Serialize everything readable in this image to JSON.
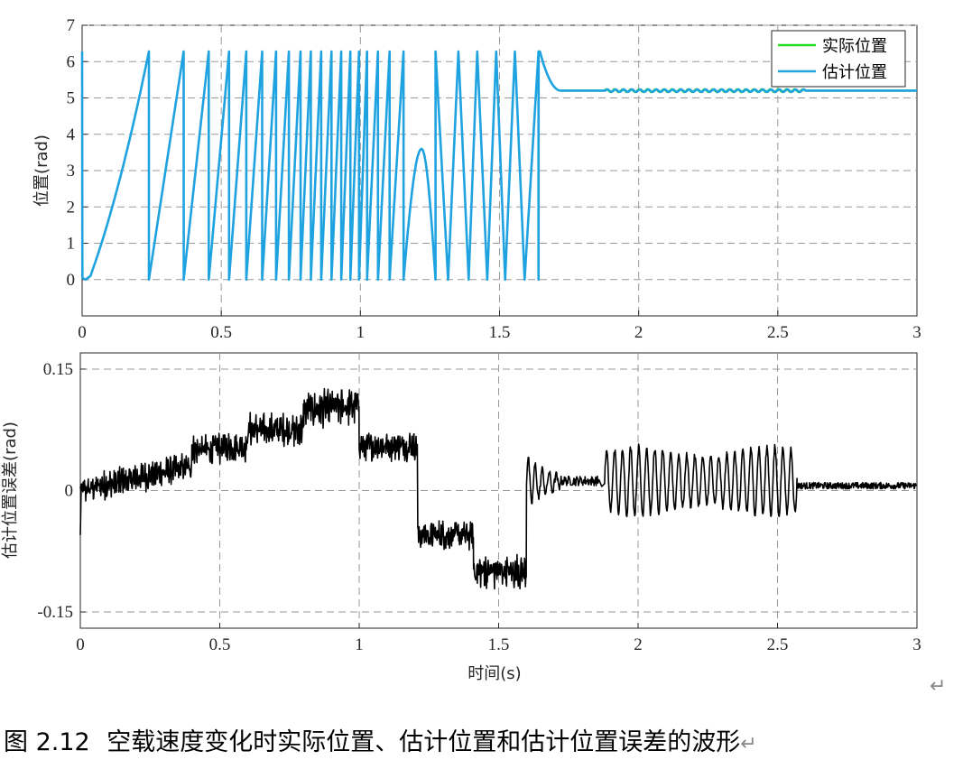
{
  "chart_data": [
    {
      "type": "line",
      "ylabel": "位置(rad)",
      "xlabel": "",
      "xlim": [
        0,
        3
      ],
      "ylim": [
        -1,
        7
      ],
      "xticks": [
        "0",
        "0.5",
        "1",
        "1.5",
        "2",
        "2.5",
        "3"
      ],
      "yticks": [
        "0",
        "1",
        "2",
        "3",
        "4",
        "5",
        "6",
        "7"
      ],
      "grid": true,
      "legend_position": "top-right",
      "series": [
        {
          "name": "实际位置",
          "color": "#22dd22"
        },
        {
          "name": "估计位置",
          "color": "#1fa3e0"
        }
      ],
      "wraps": [
        [
          0.0,
          0.24
        ],
        [
          0.24,
          0.365
        ],
        [
          0.365,
          0.455
        ],
        [
          0.455,
          0.528
        ],
        [
          0.528,
          0.59
        ],
        [
          0.59,
          0.647
        ],
        [
          0.647,
          0.697
        ],
        [
          0.697,
          0.743
        ],
        [
          0.743,
          0.785
        ],
        [
          0.785,
          0.822
        ],
        [
          0.822,
          0.859
        ],
        [
          0.859,
          0.896
        ],
        [
          0.896,
          0.931
        ],
        [
          0.931,
          0.964
        ],
        [
          0.964,
          0.995
        ],
        [
          0.995,
          1.024
        ],
        [
          1.024,
          1.063
        ],
        [
          1.063,
          1.105
        ],
        [
          1.105,
          1.155
        ]
      ],
      "bump": {
        "start": 1.155,
        "peak_t": 1.22,
        "peak_value": 3.6,
        "end": 1.27
      },
      "wraps_after_bump": [
        [
          1.27,
          1.315
        ],
        [
          1.315,
          1.352
        ],
        [
          1.352,
          1.389
        ],
        [
          1.389,
          1.42
        ],
        [
          1.42,
          1.456
        ],
        [
          1.456,
          1.488
        ],
        [
          1.488,
          1.52
        ],
        [
          1.52,
          1.555
        ],
        [
          1.555,
          1.59
        ],
        [
          1.59,
          1.64
        ]
      ],
      "steady_value": 5.2,
      "steady_start": 1.72
    },
    {
      "type": "line",
      "ylabel": "估计位置误差(rad)",
      "xlabel": "时间(s)",
      "xlim": [
        0,
        3
      ],
      "ylim": [
        -0.17,
        0.17
      ],
      "xticks": [
        "0",
        "0.5",
        "1",
        "1.5",
        "2",
        "2.5",
        "3"
      ],
      "yticks": [
        "-0.15",
        "0",
        "0.15"
      ],
      "grid": true,
      "series": [
        {
          "color": "#000000"
        }
      ],
      "segments": [
        {
          "t0": 0.0,
          "t1": 0.4,
          "v0": 0.0,
          "v1": 0.03,
          "noise": 0.013
        },
        {
          "t0": 0.4,
          "t1": 0.6,
          "v0": 0.05,
          "v1": 0.055,
          "noise": 0.014
        },
        {
          "t0": 0.6,
          "t1": 0.8,
          "v0": 0.075,
          "v1": 0.075,
          "noise": 0.015
        },
        {
          "t0": 0.8,
          "t1": 1.0,
          "v0": 0.1,
          "v1": 0.105,
          "noise": 0.017
        },
        {
          "t0": 1.0,
          "t1": 1.21,
          "v0": 0.055,
          "v1": 0.055,
          "noise": 0.013
        },
        {
          "t0": 1.21,
          "t1": 1.41,
          "v0": -0.055,
          "v1": -0.055,
          "noise": 0.013
        },
        {
          "t0": 1.41,
          "t1": 1.6,
          "v0": -0.1,
          "v1": -0.1,
          "noise": 0.016
        }
      ],
      "transient": {
        "t0": 1.6,
        "t1": 1.72,
        "start": 0.01,
        "amplitude": 0.032,
        "decay": 12
      },
      "flat": {
        "t0": 1.72,
        "t1": 1.86,
        "value": 0.012,
        "noise": 0.006
      },
      "oscillation": {
        "t0": 1.88,
        "t1": 2.57,
        "center": 0.012,
        "amplitude": 0.042,
        "cycles": 24
      },
      "tail": {
        "t0": 2.57,
        "t1": 3.0,
        "value": 0.006,
        "noise": 0.004
      }
    }
  ],
  "caption": {
    "prefix": "图 2.12",
    "text": "空载速度变化时实际位置、估计位置和估计位置误差的波形"
  },
  "marks": {
    "return_symbol": "↵"
  }
}
